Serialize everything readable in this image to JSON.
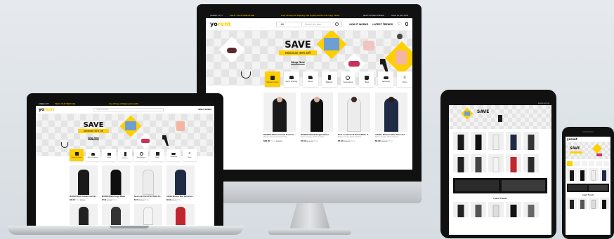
{
  "site": {
    "logo_left": "yo",
    "logo_right": "rent"
  },
  "monitor": {
    "topbar_left": "GREEK CITY",
    "topbar_help": "HELP: 212-MYRENTLINE",
    "topbar_promo": "Free 30 Days of Shipping Call 1-(281)-0674-14 & 1-0(0) 76444",
    "topbar_right_a": "NEW STORE FINDER",
    "topbar_right_b": "SIGN IN OR JOIN",
    "search_select": "All",
    "search_placeholder": "Search for item",
    "nav_a": "HOW IT WORKS",
    "nav_b": "LATEST TRENDS",
    "hero_title": "SAVE",
    "hero_sub": "Minimum 40% Off",
    "hero_cta": "Shop Now",
    "categories": [
      "Women's Lines",
      "Men's Clothing",
      "Shoes",
      "Watches",
      "Accessories",
      "Bags",
      "Gamepad",
      "More"
    ],
    "products": [
      {
        "name": "MANGO Black Casual Front Open S...",
        "brand": "Mango County, North Carolina",
        "price": "$38.00",
        "old": "$58.00",
        "off": "Price"
      },
      {
        "name": "MANGO Black Single Blazer",
        "brand": "Marco County, North Carolina",
        "price": "$7.99",
        "old": "$10.99",
        "off": "Price"
      },
      {
        "name": "Now Look Floral Print White Polyest...",
        "brand": "Marco County, North Carolina",
        "price": "$7.00",
        "old": "$30.00",
        "off": "Price"
      },
      {
        "name": "Adidas Women Blue Run Hooded S...",
        "brand": "Marco County, North Carolina",
        "price": "$9.99",
        "old": "$80.00",
        "off": "Price"
      }
    ]
  },
  "laptop": {
    "topbar_left": "GREEK CITY",
    "topbar_help": "HELP: 212-MYRENTLINE",
    "topbar_promo": "Free 30 Days of Shipping Call 1-(281)",
    "search_placeholder": "Search for item",
    "nav_a": "HOW IT WORKS",
    "hero_title": "SAVE",
    "hero_sub": "Minimum 40% Off",
    "hero_cta": "Shop Now",
    "categories": [
      "Women's Lines",
      "Men's Clothing",
      "Shoes",
      "Watches",
      "Accessories",
      "Bags",
      "Gamepad",
      "More"
    ],
    "products": [
      {
        "name": "MANGO Black Casual Front Open S...",
        "brand": "Mango County, North Carolina",
        "price": "$38.00",
        "old": "$58.00",
        "off": "Price"
      },
      {
        "name": "MANGO Black Single Blazer",
        "brand": "Marco County, North Carolina",
        "price": "$7.99",
        "old": "$10.99",
        "off": "Price"
      },
      {
        "name": "Now Look Floral Print White Polyest...",
        "brand": "Marco County, North Carolina",
        "price": "$7.00",
        "old": "$30.00",
        "off": "Price"
      },
      {
        "name": "Adidas Women Blue Run Hooded S...",
        "brand": "Marco County, North Carolina",
        "price": "$9.99",
        "old": "$80.00",
        "off": "Price"
      }
    ]
  },
  "tablet": {
    "topbar_right": "SIGN IN OR JOIN",
    "hero_title": "SAVE",
    "section_title": "Latest Trends"
  },
  "phone": {
    "logo": "yorent",
    "hero_title": "SAVE",
    "section_title": "Latest Trends"
  },
  "colors": {
    "accent": "#ffcf00",
    "dark": "#111111",
    "background": "#e0e5e9"
  }
}
